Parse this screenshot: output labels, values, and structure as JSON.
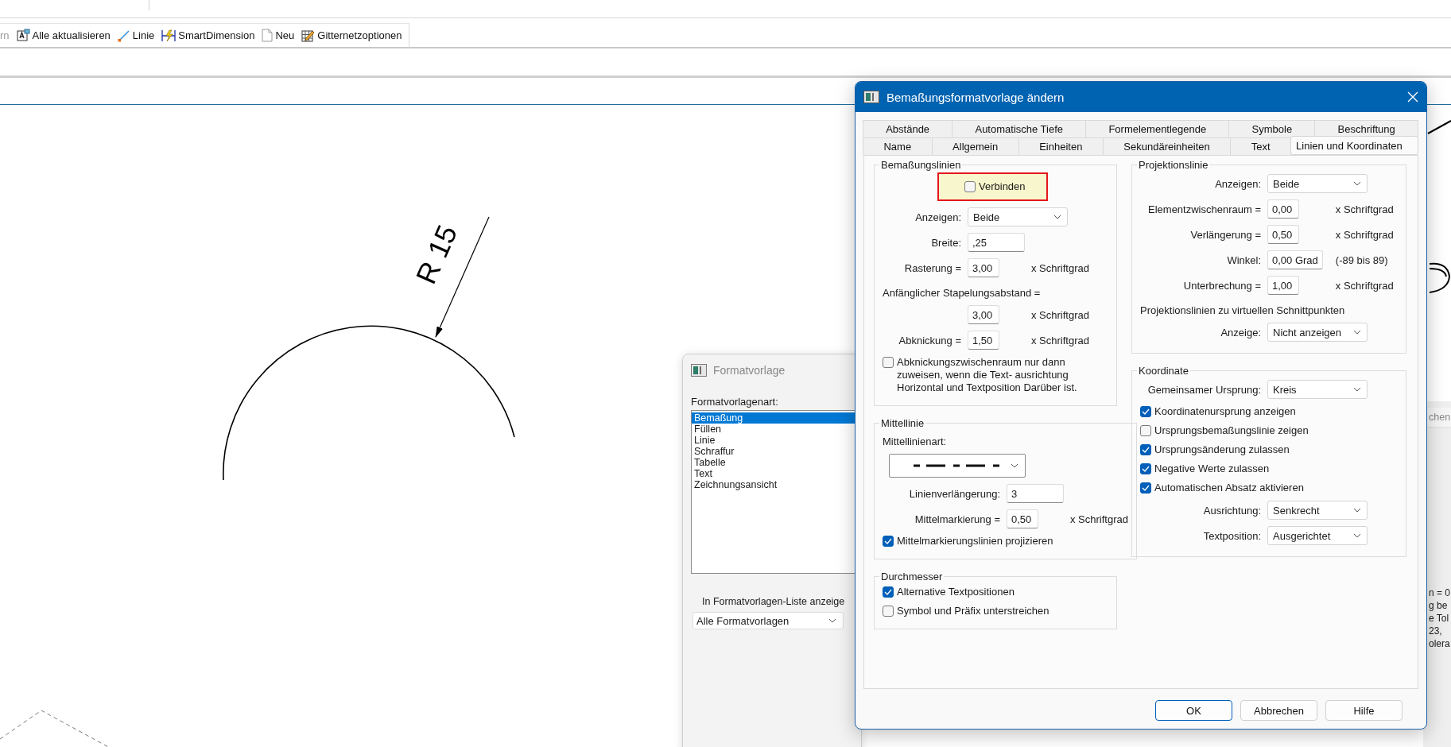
{
  "toolbar": {
    "items": [
      {
        "label": "rn",
        "disabled": true
      },
      {
        "label": "Alle aktualisieren",
        "disabled": false
      },
      {
        "label": "Linie",
        "disabled": false
      },
      {
        "label": "SmartDimension",
        "disabled": false
      },
      {
        "label": "Neu",
        "disabled": false
      },
      {
        "label": "Gitternetzoptionen",
        "disabled": false
      }
    ]
  },
  "drawing": {
    "dimension_label": "R 15"
  },
  "style_window": {
    "title": "Formatvorlage",
    "active": false,
    "list_label": "Formatvorlagenart:",
    "list_items": [
      {
        "label": "Bemaßung",
        "selected": true
      },
      {
        "label": "Füllen",
        "selected": false
      },
      {
        "label": "Linie",
        "selected": false
      },
      {
        "label": "Schraffur",
        "selected": false
      },
      {
        "label": "Tabelle",
        "selected": false
      },
      {
        "label": "Text",
        "selected": false
      },
      {
        "label": "Zeichnungsansicht",
        "selected": false
      }
    ],
    "filter_label": "In Formatvorlagen-Liste anzeige",
    "filter_value": "Alle Formatvorlagen"
  },
  "background_window": {
    "field_text": "chen",
    "lines": [
      "n = 0",
      "g be",
      "e Tol",
      "23,",
      "olera"
    ]
  },
  "dialog": {
    "title": "Bemaßungsformatvorlage ändern",
    "active": true,
    "tab_rows": [
      [
        {
          "label": "Abstände",
          "selected": false
        },
        {
          "label": "Automatische Tiefe",
          "selected": false
        },
        {
          "label": "Formelementlegende",
          "selected": false
        },
        {
          "label": "Symbole",
          "selected": false
        },
        {
          "label": "Beschriftung",
          "selected": false
        }
      ],
      [
        {
          "label": "Name",
          "selected": false
        },
        {
          "label": "Allgemein",
          "selected": false
        },
        {
          "label": "Einheiten",
          "selected": false
        },
        {
          "label": "Sekundäreinheiten",
          "selected": false
        },
        {
          "label": "Text",
          "selected": false
        },
        {
          "label": "Linien und Koordinaten",
          "selected": true
        }
      ]
    ],
    "columns": [
      [
        {
          "title": "Bemaßungslinien",
          "rows": [
            {
              "kind": "check",
              "label": "Verbinden",
              "checked": false,
              "highlighted": true
            },
            {
              "kind": "select",
              "label": "Anzeigen:",
              "value": "Beide"
            },
            {
              "kind": "field",
              "label": "Breite:",
              "value": ",25"
            },
            {
              "kind": "field",
              "label": "Rasterung =",
              "value": "3,00",
              "unit": "x Schriftgrad"
            },
            {
              "kind": "note",
              "label": "Anfänglicher Stapelungsabstand ="
            },
            {
              "kind": "field",
              "value": "3,00",
              "unit": "x Schriftgrad"
            },
            {
              "kind": "field",
              "label": "Abknickung =",
              "value": "1,50",
              "unit": "x Schriftgrad"
            },
            {
              "kind": "check",
              "label": "Abknickungszwischenraum nur dann zuweisen, wenn die Text- ausrichtung Horizontal und Textposition Darüber ist.",
              "checked": false,
              "highlighted": false
            }
          ]
        },
        {
          "title": "Mittellinie",
          "rows": [
            {
              "kind": "note",
              "label": "Mittellinienart:"
            },
            {
              "kind": "pattern"
            },
            {
              "kind": "field",
              "label": "Linienverlängerung:",
              "value": "3"
            },
            {
              "kind": "field",
              "label": "Mittelmarkierung =",
              "value": "0,50",
              "unit": "x Schriftgrad"
            },
            {
              "kind": "check",
              "label": "Mittelmarkierungslinien projizieren",
              "checked": true,
              "highlighted": false
            }
          ]
        },
        {
          "title": "Durchmesser",
          "rows": [
            {
              "kind": "check",
              "label": "Alternative Textpositionen",
              "checked": true,
              "highlighted": false
            },
            {
              "kind": "check",
              "label": "Symbol und Präfix unterstreichen",
              "checked": false,
              "highlighted": false
            }
          ]
        }
      ],
      [
        {
          "title": "Projektionslinie",
          "rows": [
            {
              "kind": "select",
              "label": "Anzeigen:",
              "value": "Beide"
            },
            {
              "kind": "field",
              "label": "Elementzwischenraum =",
              "value": "0,00",
              "unit": "x Schriftgrad"
            },
            {
              "kind": "field",
              "label": "Verlängerung =",
              "value": "0,50",
              "unit": "x Schriftgrad"
            },
            {
              "kind": "field",
              "label": "Winkel:",
              "value": "0,00 Grad",
              "unit": "(-89 bis 89)"
            },
            {
              "kind": "field",
              "label": "Unterbrechung =",
              "value": "1,00",
              "unit": "x Schriftgrad"
            },
            {
              "kind": "note",
              "label": "Projektionslinien zu virtuellen Schnittpunkten"
            },
            {
              "kind": "select",
              "label": "Anzeige:",
              "value": "Nicht anzeigen"
            }
          ]
        },
        {
          "title": "Koordinate",
          "rows": [
            {
              "kind": "select",
              "label": "Gemeinsamer Ursprung:",
              "value": "Kreis"
            },
            {
              "kind": "check",
              "label": "Koordinatenursprung anzeigen",
              "checked": true,
              "highlighted": false
            },
            {
              "kind": "check",
              "label": "Ursprungsbemaßungslinie zeigen",
              "checked": false,
              "highlighted": false
            },
            {
              "kind": "check",
              "label": "Ursprungsänderung zulassen",
              "checked": true,
              "highlighted": false
            },
            {
              "kind": "check",
              "label": "Negative Werte zulassen",
              "checked": true,
              "highlighted": false
            },
            {
              "kind": "check",
              "label": "Automatischen Absatz aktivieren",
              "checked": true,
              "highlighted": false
            },
            {
              "kind": "select",
              "label": "Ausrichtung:",
              "value": "Senkrecht"
            },
            {
              "kind": "select",
              "label": "Textposition:",
              "value": "Ausgerichtet"
            }
          ]
        }
      ]
    ],
    "buttons": [
      {
        "label": "OK",
        "default": true
      },
      {
        "label": "Abbrechen",
        "default": false
      },
      {
        "label": "Hilfe",
        "default": false
      }
    ]
  }
}
